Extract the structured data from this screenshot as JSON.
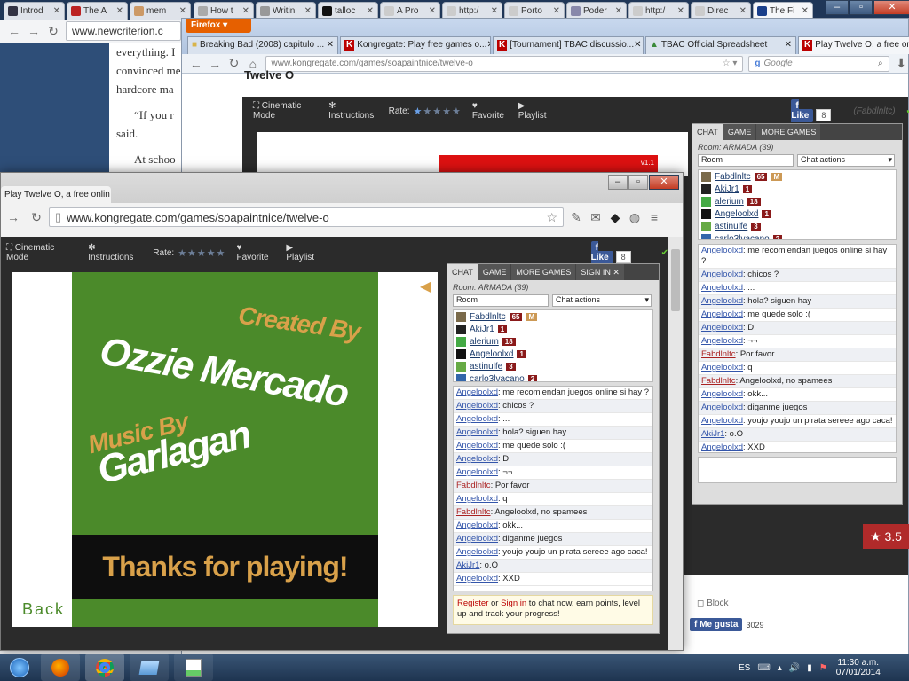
{
  "bg_tabs": [
    {
      "label": "Introd"
    },
    {
      "label": "The A"
    },
    {
      "label": "mem"
    },
    {
      "label": "How t"
    },
    {
      "label": "Writin"
    },
    {
      "label": "talloc"
    },
    {
      "label": "A Pro"
    },
    {
      "label": "http:/"
    },
    {
      "label": "Porto"
    },
    {
      "label": "Poder"
    },
    {
      "label": "http:/"
    },
    {
      "label": "Direc"
    },
    {
      "label": "The Fi"
    }
  ],
  "bg_page": {
    "url": "www.newcriterion.c",
    "lines": [
      "everything. I",
      "convinced me",
      "hardcore ma",
      "“If you r",
      "said.",
      "At schoo"
    ]
  },
  "firefox": {
    "menu_label": "Firefox",
    "tabs": [
      {
        "label": "Breaking Bad (2008) capitulo ..."
      },
      {
        "label": "Kongregate: Play free games o..."
      },
      {
        "label": "[Tournament] TBAC discussio..."
      },
      {
        "label": "TBAC Official Spreadsheet"
      },
      {
        "label": "Play Twelve O, a free online g..."
      }
    ],
    "url": "www.kongregate.com/games/soapaintnice/twelve-o",
    "search_engine": "Google",
    "search_placeholder": "Google",
    "page_title": "Twelve O",
    "gamebar": {
      "cinematic": "Cinematic Mode",
      "instructions": "Instructions",
      "rate": "Rate:",
      "favorite": "Favorite",
      "playlist": "Playlist",
      "like": "Like",
      "like_count": "8",
      "owner": "(Fabdlnltc)"
    },
    "game_version": "v1.1",
    "chat": {
      "tabs": [
        "CHAT",
        "GAME",
        "MORE GAMES"
      ],
      "room_label": "Room: ARMADA (39)",
      "room_select": "Room",
      "actions_select": "Chat actions",
      "users": [
        {
          "name": "Fabdlnltc",
          "level": "65",
          "mod": "M"
        },
        {
          "name": "AkiJr1",
          "level": "1"
        },
        {
          "name": "alerium",
          "level": "18"
        },
        {
          "name": "Angeloolxd",
          "level": "1"
        },
        {
          "name": "astinulfe",
          "level": "3"
        },
        {
          "name": "carlo3lvacano",
          "level": "2"
        }
      ],
      "messages": [
        {
          "user": "Angeloolxd",
          "text": ": me recomiendan juegos online si hay ?"
        },
        {
          "user": "Angeloolxd",
          "text": ": chicos ?"
        },
        {
          "user": "Angeloolxd",
          "text": ": ..."
        },
        {
          "user": "Angeloolxd",
          "text": ": hola? siguen hay"
        },
        {
          "user": "Angeloolxd",
          "text": ": me quede solo :("
        },
        {
          "user": "Angeloolxd",
          "text": ": D:"
        },
        {
          "user": "Angeloolxd",
          "text": ": ¬¬"
        },
        {
          "user": "Fabdlnltc",
          "text": ": Por favor",
          "red": true
        },
        {
          "user": "Angeloolxd",
          "text": ": q"
        },
        {
          "user": "Fabdlnltc",
          "text": ": Angeloolxd, no spamees",
          "red": true
        },
        {
          "user": "Angeloolxd",
          "text": ": okk..."
        },
        {
          "user": "Angeloolxd",
          "text": ": diganme juegos"
        },
        {
          "user": "Angeloolxd",
          "text": ": youjo youjo un pirata sereee ago caca!"
        },
        {
          "user": "AkiJr1",
          "text": ": o.O"
        },
        {
          "user": "Angeloolxd",
          "text": ": XXD"
        }
      ]
    },
    "rating_badge": "3.5",
    "block_label": "Block",
    "me_gusta": "Me gusta",
    "me_gusta_count": "3029"
  },
  "chrome": {
    "tab_label": "Play Twelve O, a free onlin",
    "url": "www.kongregate.com/games/soapaintnice/twelve-o",
    "gamebar": {
      "cinematic": "Cinematic Mode",
      "instructions": "Instructions",
      "rate": "Rate:",
      "favorite": "Favorite",
      "playlist": "Playlist",
      "like": "Like",
      "like_count": "8"
    },
    "game": {
      "created_by": "Created By",
      "author": "Ozzie Mercado",
      "music_by": "Music By",
      "composer": "Garlagan",
      "thanks": "Thanks for playing!",
      "back": "Back"
    },
    "chat": {
      "tabs": [
        "CHAT",
        "GAME",
        "MORE GAMES",
        "SIGN IN"
      ],
      "room_label": "Room: ARMADA (39)",
      "room_select": "Room",
      "actions_select": "Chat actions",
      "register": "Register",
      "or": " or ",
      "signin": "Sign in",
      "cta": " to chat now, earn points, level up and track your progress!"
    }
  },
  "taskbar": {
    "lang": "ES",
    "time": "11:30 a.m.",
    "date": "07/01/2014"
  },
  "colors": {
    "game_green": "#4b8a2a",
    "game_orange": "#d9a14a",
    "chrome_bg": "#f2f2f2",
    "kong_dark": "#2b2b2b",
    "kong_red": "#990000"
  }
}
